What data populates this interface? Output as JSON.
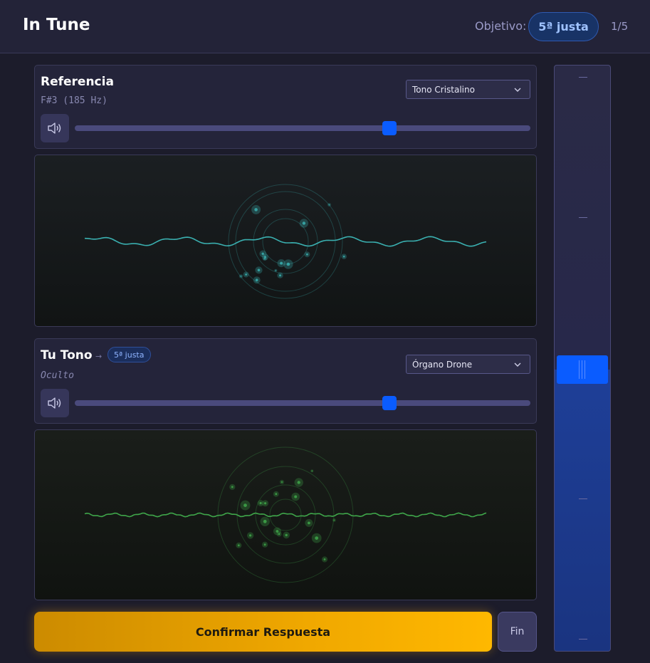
{
  "header": {
    "title": "In Tune",
    "objective_label": "Objetivo:",
    "objective_value": "5ª justa",
    "progress": "1/5"
  },
  "reference": {
    "title": "Referencia",
    "note": "F#3 (185 Hz)",
    "instrument": "Tono Cristalino",
    "volume": 0.69,
    "wave_color": "#3ab0b0"
  },
  "user_tone": {
    "title": "Tu Tono",
    "arrow": "→",
    "interval_badge": "5ª justa",
    "note": "Oculto",
    "instrument": "Órgano Drone",
    "volume": 0.69,
    "wave_color": "#3fa64a"
  },
  "actions": {
    "confirm_label": "Confirmar Respuesta",
    "end_label": "Fin"
  },
  "tuner": {
    "level": 0.48,
    "accent": "#0a5cff"
  }
}
